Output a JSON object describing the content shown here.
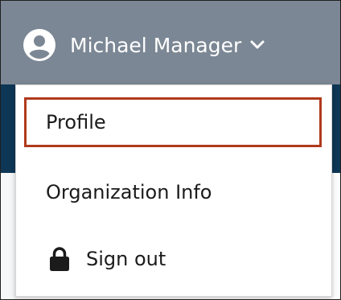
{
  "header": {
    "user_name": "Michael Manager",
    "user_icon": "user-circle-icon",
    "caret_icon": "chevron-down-icon"
  },
  "menu": {
    "items": [
      {
        "label": "Profile",
        "highlighted": true
      },
      {
        "label": "Organization Info"
      },
      {
        "label": "Sign out",
        "icon": "lock-icon"
      }
    ]
  },
  "colors": {
    "header_bg": "#7b8794",
    "band_bg": "#0e3655",
    "highlight_border": "#b03a1c",
    "text": "#1b1b1b"
  }
}
